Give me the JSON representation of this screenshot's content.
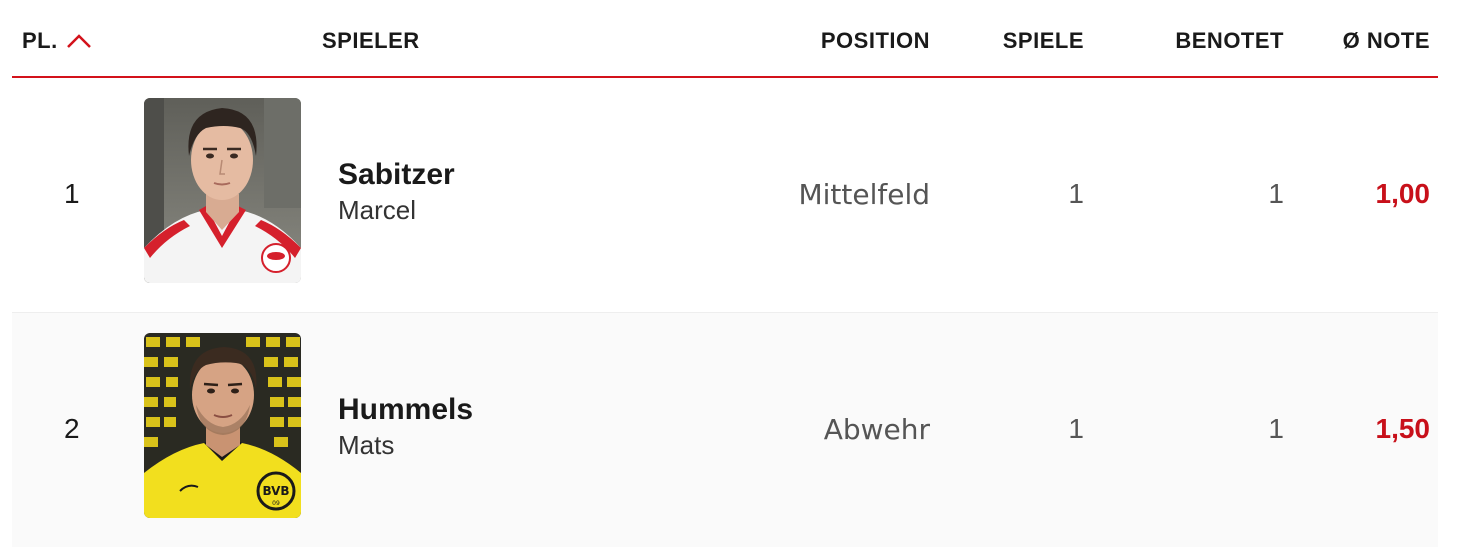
{
  "header": {
    "rank_label": "PL.",
    "player_label": "SPIELER",
    "position_label": "POSITION",
    "games_label": "SPIELE",
    "rated_label": "BENOTET",
    "avg_grade_label": "Ø NOTE",
    "sort_icon": "chevron-up-icon"
  },
  "colors": {
    "accent": "#d3121b",
    "grade": "#c8101a"
  },
  "players": [
    {
      "rank": "1",
      "last_name": "Sabitzer",
      "first_name": "Marcel",
      "position": "Mittelfeld",
      "games": "1",
      "rated": "1",
      "grade": "1,00"
    },
    {
      "rank": "2",
      "last_name": "Hummels",
      "first_name": "Mats",
      "position": "Abwehr",
      "games": "1",
      "rated": "1",
      "grade": "1,50"
    }
  ]
}
